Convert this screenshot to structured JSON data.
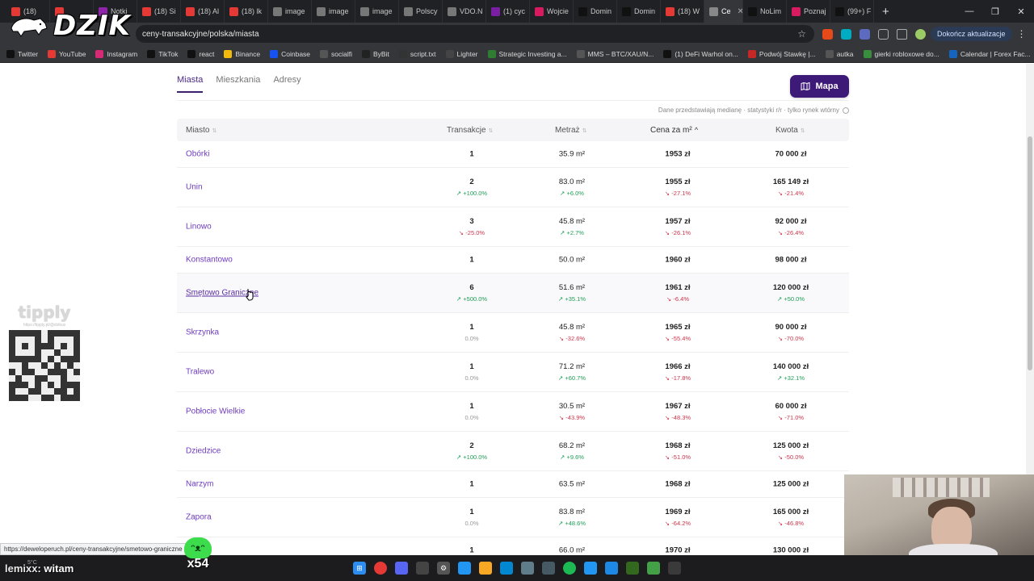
{
  "browser": {
    "tabs": [
      {
        "label": "(18)",
        "color": "#e53935"
      },
      {
        "label": "",
        "color": "#e53935"
      },
      {
        "label": "Notki",
        "color": "#8e24aa"
      },
      {
        "label": "(18) Si",
        "color": "#e53935"
      },
      {
        "label": "(18) Al",
        "color": "#e53935"
      },
      {
        "label": "(18) lk",
        "color": "#e53935"
      },
      {
        "label": "image",
        "color": "#777777"
      },
      {
        "label": "image",
        "color": "#777777"
      },
      {
        "label": "image",
        "color": "#777777"
      },
      {
        "label": "Polscy",
        "color": "#777777"
      },
      {
        "label": "VDO.N",
        "color": "#777777"
      },
      {
        "label": "(1) cyc",
        "color": "#7b1fa2"
      },
      {
        "label": "Wojcie",
        "color": "#d81b60"
      },
      {
        "label": "Domin",
        "color": "#111111"
      },
      {
        "label": "Domin",
        "color": "#111111"
      },
      {
        "label": "(18) W",
        "color": "#e53935"
      },
      {
        "label": "Ce",
        "color": "#888888",
        "active": true
      },
      {
        "label": "NoLim",
        "color": "#111111"
      },
      {
        "label": "Poznaj",
        "color": "#d81b60"
      },
      {
        "label": "(99+) F",
        "color": "#111111"
      }
    ],
    "url": "ceny-transakcyjne/polska/miasta",
    "update_button": "Dokończ aktualizacje",
    "bookmarks": [
      {
        "label": "Twitter",
        "icon": "x-icon",
        "color": "#111111"
      },
      {
        "label": "YouTube",
        "icon": "youtube-icon",
        "color": "#e53935"
      },
      {
        "label": "Instagram",
        "icon": "instagram-icon",
        "color": "#d62976"
      },
      {
        "label": "TikTok",
        "icon": "tiktok-icon",
        "color": "#111111"
      },
      {
        "label": "react",
        "icon": "tiktok-icon",
        "color": "#111111"
      },
      {
        "label": "Binance",
        "icon": "binance-icon",
        "color": "#f0b90b"
      },
      {
        "label": "Coinbase",
        "icon": "coinbase-icon",
        "color": "#1652f0"
      },
      {
        "label": "socialfi",
        "icon": "folder-icon",
        "color": "#555555"
      },
      {
        "label": "ByBit",
        "icon": "bybit-icon",
        "color": "#222222"
      },
      {
        "label": "script.txt",
        "icon": "github-icon",
        "color": "#333333"
      },
      {
        "label": "Lighter",
        "icon": "lighter-icon",
        "color": "#444444"
      },
      {
        "label": "Strategic Investing a...",
        "icon": "chart-icon",
        "color": "#2e7d32"
      },
      {
        "label": "MMS – BTC/XAU/N...",
        "icon": "globe-icon",
        "color": "#555555"
      },
      {
        "label": "(1) DeFi Warhol on...",
        "icon": "x-icon",
        "color": "#111111"
      },
      {
        "label": "Podwój Stawkę |...",
        "icon": "dice-icon",
        "color": "#c62828"
      },
      {
        "label": "autka",
        "icon": "folder-icon",
        "color": "#555555"
      },
      {
        "label": "gierki robloxowe do...",
        "icon": "game-icon",
        "color": "#388e3c"
      },
      {
        "label": "Calendar | Forex Fac...",
        "icon": "calendar-icon",
        "color": "#1565c0"
      }
    ]
  },
  "overlay": {
    "logo_text": "DZIK",
    "tipply": "tipply",
    "tipply_url": "https://tipply.pl/@dzikus",
    "status_url": "https://deweloperuch.pl/ceny-transakcyjne/smetowo-graniczne",
    "chat_nick": "lemixx",
    "chat_msg": ": witam",
    "weather": "5°C",
    "emote_count": "x54",
    "emote_face": "ᵔᴥᵔ"
  },
  "page": {
    "tabs": [
      "Miasta",
      "Mieszkania",
      "Adresy"
    ],
    "active_tab": "Miasta",
    "map_button": "Mapa",
    "note": "Dane przedstawiają medianę · statystyki r/r · tylko rynek wtórny",
    "columns": {
      "city": "Miasto",
      "tr": "Transakcje",
      "m": "Metraż",
      "p": "Cena za m²",
      "k": "Kwota"
    },
    "rows": [
      {
        "city": "Obórki",
        "tr": "1",
        "m": "35.9 m²",
        "p": "1953 zł",
        "k": "70 000 zł"
      },
      {
        "city": "Unin",
        "tr": "2",
        "tr_d": "+100.0%",
        "tr_t": "up",
        "m": "83.0 m²",
        "m_d": "+6.0%",
        "m_t": "up",
        "p": "1955 zł",
        "p_d": "-27.1%",
        "p_t": "down",
        "k": "165 149 zł",
        "k_d": "-21.4%",
        "k_t": "down"
      },
      {
        "city": "Linowo",
        "tr": "3",
        "tr_d": "-25.0%",
        "tr_t": "down",
        "m": "45.8 m²",
        "m_d": "+2.7%",
        "m_t": "up",
        "p": "1957 zł",
        "p_d": "-26.1%",
        "p_t": "down",
        "k": "92 000 zł",
        "k_d": "-26.4%",
        "k_t": "down"
      },
      {
        "city": "Konstantowo",
        "tr": "1",
        "m": "50.0 m²",
        "p": "1960 zł",
        "k": "98 000 zł"
      },
      {
        "city": "Smętowo Graniczne",
        "hover": true,
        "tr": "6",
        "tr_d": "+500.0%",
        "tr_t": "up",
        "m": "51.6 m²",
        "m_d": "+35.1%",
        "m_t": "up",
        "p": "1961 zł",
        "p_d": "-6.4%",
        "p_t": "down",
        "k": "120 000 zł",
        "k_d": "+50.0%",
        "k_t": "up"
      },
      {
        "city": "Skrzynka",
        "tr": "1",
        "tr_d": "0.0%",
        "tr_t": "neutral",
        "m": "45.8 m²",
        "m_d": "-32.6%",
        "m_t": "down",
        "p": "1965 zł",
        "p_d": "-55.4%",
        "p_t": "down",
        "k": "90 000 zł",
        "k_d": "-70.0%",
        "k_t": "down"
      },
      {
        "city": "Tralewo",
        "tr": "1",
        "tr_d": "0.0%",
        "tr_t": "neutral",
        "m": "71.2 m²",
        "m_d": "+60.7%",
        "m_t": "up",
        "p": "1966 zł",
        "p_d": "-17.8%",
        "p_t": "down",
        "k": "140 000 zł",
        "k_d": "+32.1%",
        "k_t": "up"
      },
      {
        "city": "Pobłocie Wielkie",
        "tr": "1",
        "tr_d": "0.0%",
        "tr_t": "neutral",
        "m": "30.5 m²",
        "m_d": "-43.9%",
        "m_t": "down",
        "p": "1967 zł",
        "p_d": "-48.3%",
        "p_t": "down",
        "k": "60 000 zł",
        "k_d": "-71.0%",
        "k_t": "down"
      },
      {
        "city": "Dziedzice",
        "tr": "2",
        "tr_d": "+100.0%",
        "tr_t": "up",
        "m": "68.2 m²",
        "m_d": "+9.6%",
        "m_t": "up",
        "p": "1968 zł",
        "p_d": "-51.0%",
        "p_t": "down",
        "k": "125 000 zł",
        "k_d": "-50.0%",
        "k_t": "down"
      },
      {
        "city": "Narzym",
        "tr": "1",
        "m": "63.5 m²",
        "p": "1968 zł",
        "k": "125 000 zł"
      },
      {
        "city": "Zapora",
        "tr": "1",
        "tr_d": "0.0%",
        "tr_t": "neutral",
        "m": "83.8 m²",
        "m_d": "+48.6%",
        "m_t": "up",
        "p": "1969 zł",
        "p_d": "-64.2%",
        "p_t": "down",
        "k": "165 000 zł",
        "k_d": "-46.8%",
        "k_t": "down"
      },
      {
        "city": "",
        "tr": "1",
        "m": "66.0 m²",
        "p": "1970 zł",
        "k": "130 000 zł"
      }
    ]
  }
}
